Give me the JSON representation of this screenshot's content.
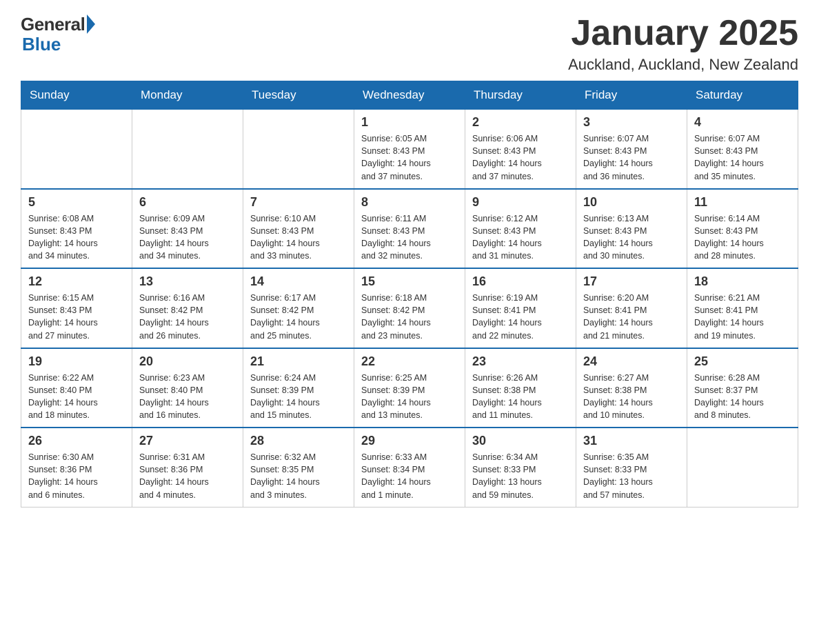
{
  "logo": {
    "general": "General",
    "blue": "Blue"
  },
  "header": {
    "title": "January 2025",
    "location": "Auckland, Auckland, New Zealand"
  },
  "weekdays": [
    "Sunday",
    "Monday",
    "Tuesday",
    "Wednesday",
    "Thursday",
    "Friday",
    "Saturday"
  ],
  "weeks": [
    [
      {
        "day": "",
        "info": ""
      },
      {
        "day": "",
        "info": ""
      },
      {
        "day": "",
        "info": ""
      },
      {
        "day": "1",
        "info": "Sunrise: 6:05 AM\nSunset: 8:43 PM\nDaylight: 14 hours\nand 37 minutes."
      },
      {
        "day": "2",
        "info": "Sunrise: 6:06 AM\nSunset: 8:43 PM\nDaylight: 14 hours\nand 37 minutes."
      },
      {
        "day": "3",
        "info": "Sunrise: 6:07 AM\nSunset: 8:43 PM\nDaylight: 14 hours\nand 36 minutes."
      },
      {
        "day": "4",
        "info": "Sunrise: 6:07 AM\nSunset: 8:43 PM\nDaylight: 14 hours\nand 35 minutes."
      }
    ],
    [
      {
        "day": "5",
        "info": "Sunrise: 6:08 AM\nSunset: 8:43 PM\nDaylight: 14 hours\nand 34 minutes."
      },
      {
        "day": "6",
        "info": "Sunrise: 6:09 AM\nSunset: 8:43 PM\nDaylight: 14 hours\nand 34 minutes."
      },
      {
        "day": "7",
        "info": "Sunrise: 6:10 AM\nSunset: 8:43 PM\nDaylight: 14 hours\nand 33 minutes."
      },
      {
        "day": "8",
        "info": "Sunrise: 6:11 AM\nSunset: 8:43 PM\nDaylight: 14 hours\nand 32 minutes."
      },
      {
        "day": "9",
        "info": "Sunrise: 6:12 AM\nSunset: 8:43 PM\nDaylight: 14 hours\nand 31 minutes."
      },
      {
        "day": "10",
        "info": "Sunrise: 6:13 AM\nSunset: 8:43 PM\nDaylight: 14 hours\nand 30 minutes."
      },
      {
        "day": "11",
        "info": "Sunrise: 6:14 AM\nSunset: 8:43 PM\nDaylight: 14 hours\nand 28 minutes."
      }
    ],
    [
      {
        "day": "12",
        "info": "Sunrise: 6:15 AM\nSunset: 8:43 PM\nDaylight: 14 hours\nand 27 minutes."
      },
      {
        "day": "13",
        "info": "Sunrise: 6:16 AM\nSunset: 8:42 PM\nDaylight: 14 hours\nand 26 minutes."
      },
      {
        "day": "14",
        "info": "Sunrise: 6:17 AM\nSunset: 8:42 PM\nDaylight: 14 hours\nand 25 minutes."
      },
      {
        "day": "15",
        "info": "Sunrise: 6:18 AM\nSunset: 8:42 PM\nDaylight: 14 hours\nand 23 minutes."
      },
      {
        "day": "16",
        "info": "Sunrise: 6:19 AM\nSunset: 8:41 PM\nDaylight: 14 hours\nand 22 minutes."
      },
      {
        "day": "17",
        "info": "Sunrise: 6:20 AM\nSunset: 8:41 PM\nDaylight: 14 hours\nand 21 minutes."
      },
      {
        "day": "18",
        "info": "Sunrise: 6:21 AM\nSunset: 8:41 PM\nDaylight: 14 hours\nand 19 minutes."
      }
    ],
    [
      {
        "day": "19",
        "info": "Sunrise: 6:22 AM\nSunset: 8:40 PM\nDaylight: 14 hours\nand 18 minutes."
      },
      {
        "day": "20",
        "info": "Sunrise: 6:23 AM\nSunset: 8:40 PM\nDaylight: 14 hours\nand 16 minutes."
      },
      {
        "day": "21",
        "info": "Sunrise: 6:24 AM\nSunset: 8:39 PM\nDaylight: 14 hours\nand 15 minutes."
      },
      {
        "day": "22",
        "info": "Sunrise: 6:25 AM\nSunset: 8:39 PM\nDaylight: 14 hours\nand 13 minutes."
      },
      {
        "day": "23",
        "info": "Sunrise: 6:26 AM\nSunset: 8:38 PM\nDaylight: 14 hours\nand 11 minutes."
      },
      {
        "day": "24",
        "info": "Sunrise: 6:27 AM\nSunset: 8:38 PM\nDaylight: 14 hours\nand 10 minutes."
      },
      {
        "day": "25",
        "info": "Sunrise: 6:28 AM\nSunset: 8:37 PM\nDaylight: 14 hours\nand 8 minutes."
      }
    ],
    [
      {
        "day": "26",
        "info": "Sunrise: 6:30 AM\nSunset: 8:36 PM\nDaylight: 14 hours\nand 6 minutes."
      },
      {
        "day": "27",
        "info": "Sunrise: 6:31 AM\nSunset: 8:36 PM\nDaylight: 14 hours\nand 4 minutes."
      },
      {
        "day": "28",
        "info": "Sunrise: 6:32 AM\nSunset: 8:35 PM\nDaylight: 14 hours\nand 3 minutes."
      },
      {
        "day": "29",
        "info": "Sunrise: 6:33 AM\nSunset: 8:34 PM\nDaylight: 14 hours\nand 1 minute."
      },
      {
        "day": "30",
        "info": "Sunrise: 6:34 AM\nSunset: 8:33 PM\nDaylight: 13 hours\nand 59 minutes."
      },
      {
        "day": "31",
        "info": "Sunrise: 6:35 AM\nSunset: 8:33 PM\nDaylight: 13 hours\nand 57 minutes."
      },
      {
        "day": "",
        "info": ""
      }
    ]
  ]
}
